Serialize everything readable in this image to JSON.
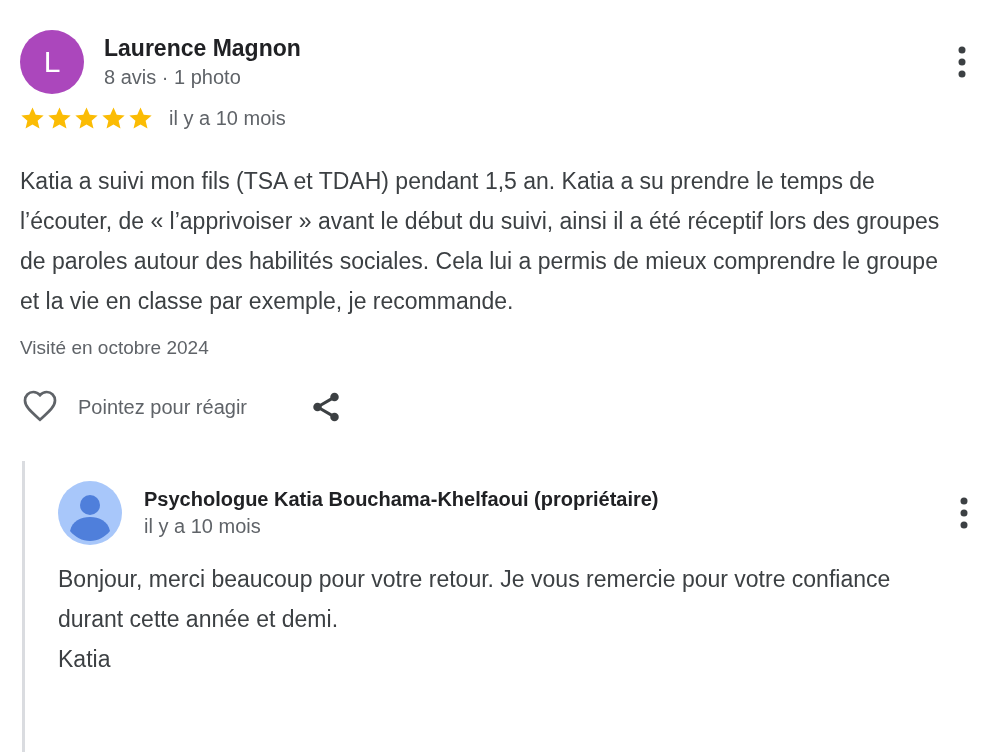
{
  "review": {
    "author": {
      "initial": "L",
      "name": "Laurence Magnon",
      "meta": "8 avis · 1 photo"
    },
    "stars": 5,
    "time": "il y a 10 mois",
    "text": "Katia a suivi mon fils (TSA et TDAH) pendant 1,5 an. Katia a su prendre le temps de l’écouter, de « l’apprivoiser » avant le début du suivi, ainsi il a été réceptif lors des groupes de paroles autour des habilités sociales. Cela lui a permis de mieux comprendre le groupe et la vie en classe par exemple, je recommande.",
    "visited": "Visité en octobre 2024",
    "react_label": "Pointez pour réagir"
  },
  "reply": {
    "author": "Psychologue Katia Bouchama-Khelfaoui (propriétaire)",
    "time": "il y a 10 mois",
    "text": "Bonjour, merci beaucoup pour votre retour. Je vous remercie pour votre confiance durant cette année et demi.\nKatia"
  }
}
